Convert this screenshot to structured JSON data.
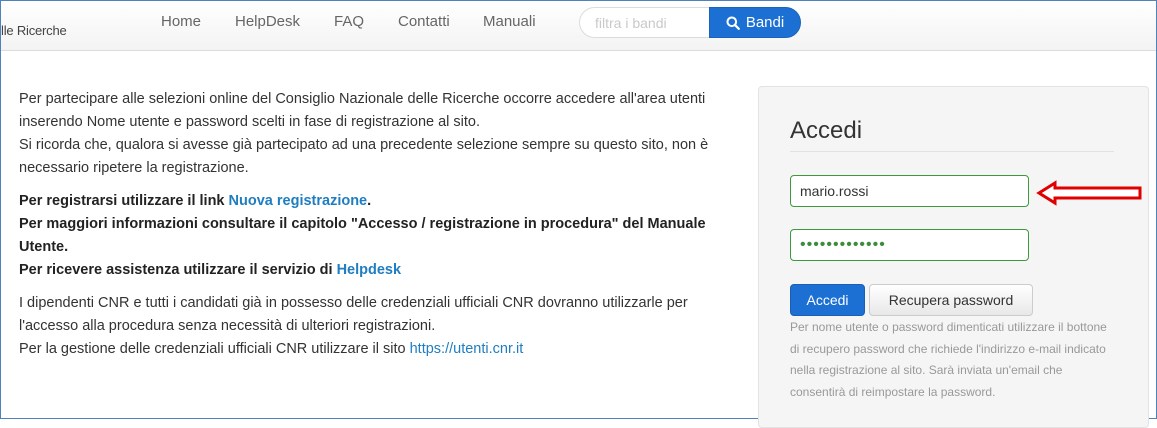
{
  "nav": {
    "brand": "lle Ricerche",
    "items": [
      "Home",
      "HelpDesk",
      "FAQ",
      "Contatti",
      "Manuali"
    ],
    "search_placeholder": "filtra i bandi",
    "search_button": "Bandi"
  },
  "intro": {
    "p1": "Per partecipare alle selezioni online del Consiglio Nazionale delle Ricerche occorre accedere all'area utenti inserendo Nome utente e password scelti in fase di registrazione al sito.",
    "p1b": "Si ricorda che, qualora si avesse già partecipato ad una precedente selezione sempre su questo sito, non è necessario ripetere la registrazione.",
    "reg_prefix": "Per registrarsi utilizzare il link ",
    "reg_link": "Nuova registrazione",
    "reg_suffix": ".",
    "info": "Per maggiori informazioni consultare il capitolo \"Accesso / registrazione in procedura\" del Manuale Utente.",
    "assist_prefix": "Per ricevere assistenza utilizzare il servizio di ",
    "assist_link": "Helpdesk",
    "cnr": "I dipendenti CNR e tutti i candidati già in possesso delle credenziali ufficiali CNR dovranno utilizzarle per l'accesso alla procedura senza necessità di ulteriori registrazioni.",
    "cnr2_prefix": "Per la gestione delle credenziali ufficiali CNR utilizzare il sito ",
    "cnr2_link": "https://utenti.cnr.it"
  },
  "login": {
    "title": "Accedi",
    "username": "mario.rossi",
    "password": "•••••••••••••",
    "submit": "Accedi",
    "recover": "Recupera password",
    "help": "Per nome utente o password dimenticati utilizzare il bottone di recupero password che richiede l'indirizzo e-mail indicato nella registrazione al sito. Sarà inviata un'email che consentirà di reimpostare la password."
  },
  "colors": {
    "accent": "#1c6fd3",
    "link": "#1f7dc1",
    "valid_border": "#3c9a3c",
    "annotation_arrow": "#e00000"
  }
}
